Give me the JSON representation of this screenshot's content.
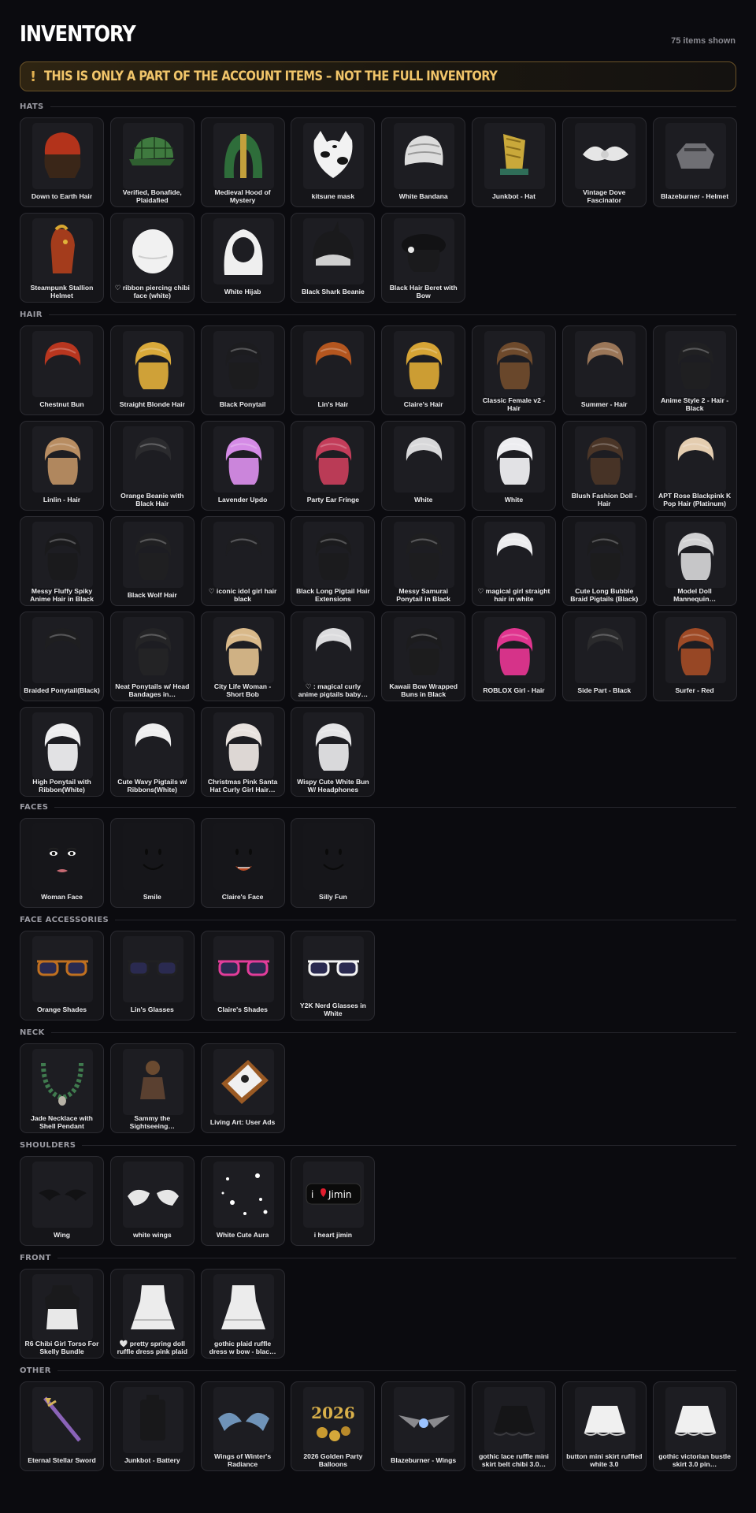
{
  "page": {
    "title": "INVENTORY",
    "count_label": "75 items shown",
    "warning_icon": "!",
    "warning_text": "THIS IS ONLY A PART OF THE ACCOUNT ITEMS – NOT THE FULL INVENTORY"
  },
  "colors": {
    "background": "#0b0b0f",
    "card": "#151519",
    "warning_text": "#f1c56a",
    "warning_border": "#6b5328"
  },
  "sections": [
    {
      "title": "HATS",
      "items": [
        {
          "name": "Down to Earth Hair",
          "icon": "red-beanie-hair"
        },
        {
          "name": "Verified, Bonafide, Plaidafied",
          "icon": "green-plaid-cap"
        },
        {
          "name": "Medieval Hood of Mystery",
          "icon": "green-hood"
        },
        {
          "name": "kitsune mask",
          "icon": "cow-print-mask"
        },
        {
          "name": "White Bandana",
          "icon": "bandana"
        },
        {
          "name": "Junkbot - Hat",
          "icon": "yellow-robot-hat"
        },
        {
          "name": "Vintage Dove Fascinator",
          "icon": "dove-fascinator"
        },
        {
          "name": "Blazeburner - Helmet",
          "icon": "grey-helmet"
        },
        {
          "name": "Steampunk Stallion Helmet",
          "icon": "horse-helmet"
        },
        {
          "name": "♡ ribbon piercing chibi face (white)",
          "icon": "white-chibi-head"
        },
        {
          "name": "White Hijab",
          "icon": "white-hijab"
        },
        {
          "name": "Black Shark Beanie",
          "icon": "shark-beanie"
        },
        {
          "name": "Black Hair Beret with Bow",
          "icon": "black-beret"
        }
      ]
    },
    {
      "title": "HAIR",
      "items": [
        {
          "name": "Chestnut Bun",
          "icon": "hair"
        },
        {
          "name": "Straight Blonde Hair",
          "icon": "hair"
        },
        {
          "name": "Black Ponytail",
          "icon": "hair"
        },
        {
          "name": "Lin's Hair",
          "icon": "hair"
        },
        {
          "name": "Claire's Hair",
          "icon": "hair"
        },
        {
          "name": "Classic Female v2 - Hair",
          "icon": "hair"
        },
        {
          "name": "Summer - Hair",
          "icon": "hair"
        },
        {
          "name": "Anime Style 2 - Hair - Black",
          "icon": "hair"
        },
        {
          "name": "Linlin - Hair",
          "icon": "hair"
        },
        {
          "name": "Orange Beanie with Black Hair",
          "icon": "hair"
        },
        {
          "name": "Lavender Updo",
          "icon": "hair"
        },
        {
          "name": "Party Ear Fringe",
          "icon": "hair"
        },
        {
          "name": "White",
          "icon": "hair"
        },
        {
          "name": "White",
          "icon": "hair"
        },
        {
          "name": "Blush Fashion Doll - Hair",
          "icon": "hair"
        },
        {
          "name": "APT Rose Blackpink K Pop Hair (Platinum)",
          "icon": "hair"
        },
        {
          "name": "Messy Fluffy Spiky Anime Hair in Black",
          "icon": "hair"
        },
        {
          "name": "Black Wolf Hair",
          "icon": "hair"
        },
        {
          "name": "♡ iconic idol girl hair black",
          "icon": "hair"
        },
        {
          "name": "Black Long Pigtail Hair Extensions",
          "icon": "hair"
        },
        {
          "name": "Messy Samurai Ponytail in Black",
          "icon": "hair"
        },
        {
          "name": "♡ magical girl straight hair in white",
          "icon": "hair"
        },
        {
          "name": "Cute Long Bubble Braid Pigtails (Black)",
          "icon": "hair"
        },
        {
          "name": "Model Doll Mannequin…",
          "icon": "hair"
        },
        {
          "name": "Braided Ponytail(Black)",
          "icon": "hair"
        },
        {
          "name": "Neat Ponytails w/ Head Bandages in…",
          "icon": "hair"
        },
        {
          "name": "City Life Woman - Short Bob",
          "icon": "hair"
        },
        {
          "name": "♡ : magical curly anime pigtails baby…",
          "icon": "hair"
        },
        {
          "name": "Kawaii Bow Wrapped Buns in Black",
          "icon": "hair"
        },
        {
          "name": "ROBLOX Girl - Hair",
          "icon": "hair"
        },
        {
          "name": "Side Part - Black",
          "icon": "hair"
        },
        {
          "name": "Surfer - Red",
          "icon": "hair"
        },
        {
          "name": "High Ponytail with Ribbon(White)",
          "icon": "hair"
        },
        {
          "name": "Cute Wavy Pigtails w/ Ribbons(White)",
          "icon": "hair"
        },
        {
          "name": "Christmas Pink Santa Hat Curly Girl Hair…",
          "icon": "hair"
        },
        {
          "name": "Wispy Cute White Bun W/ Headphones",
          "icon": "hair"
        }
      ]
    },
    {
      "title": "FACES",
      "items": [
        {
          "name": "Woman Face",
          "icon": "face"
        },
        {
          "name": "Smile",
          "icon": "face"
        },
        {
          "name": "Claire's Face",
          "icon": "face"
        },
        {
          "name": "Silly Fun",
          "icon": "face"
        }
      ]
    },
    {
      "title": "FACE ACCESSORIES",
      "items": [
        {
          "name": "Orange Shades",
          "icon": "glasses"
        },
        {
          "name": "Lin's Glasses",
          "icon": "glasses"
        },
        {
          "name": "Claire's Shades",
          "icon": "glasses"
        },
        {
          "name": "Y2K Nerd Glasses in White",
          "icon": "glasses"
        }
      ]
    },
    {
      "title": "NECK",
      "items": [
        {
          "name": "Jade Necklace with Shell Pendant",
          "icon": "necklace"
        },
        {
          "name": "Sammy the Sightseeing…",
          "icon": "figure"
        },
        {
          "name": "Living Art: User Ads",
          "icon": "frame"
        }
      ]
    },
    {
      "title": "SHOULDERS",
      "items": [
        {
          "name": "Wing",
          "icon": "bat-wings"
        },
        {
          "name": "white wings",
          "icon": "white-wings"
        },
        {
          "name": "White Cute Aura",
          "icon": "aura"
        },
        {
          "name": "i heart jimin",
          "icon": "sign",
          "sign_text": "Jimin"
        }
      ]
    },
    {
      "title": "FRONT",
      "items": [
        {
          "name": "R6 Chibi Girl Torso For Skelly Bundle",
          "icon": "torso"
        },
        {
          "name": "🤍 pretty spring doll ruffle dress pink plaid",
          "icon": "dress"
        },
        {
          "name": "gothic plaid ruffle dress w bow - blac…",
          "icon": "dress"
        }
      ]
    },
    {
      "title": "OTHER",
      "items": [
        {
          "name": "Eternal Stellar Sword",
          "icon": "sword"
        },
        {
          "name": "Junkbot - Battery",
          "icon": "battery"
        },
        {
          "name": "Wings of Winter's Radiance",
          "icon": "blue-wings"
        },
        {
          "name": "2026 Golden Party Balloons",
          "icon": "balloons",
          "balloon_text": "2026"
        },
        {
          "name": "Blazeburner - Wings",
          "icon": "mech-wings"
        },
        {
          "name": "gothic lace ruffle mini skirt belt chibi 3.0…",
          "icon": "skirt"
        },
        {
          "name": "button mini skirt ruffled white 3.0",
          "icon": "skirt"
        },
        {
          "name": "gothic victorian bustle skirt 3.0 pin…",
          "icon": "skirt"
        }
      ]
    }
  ]
}
